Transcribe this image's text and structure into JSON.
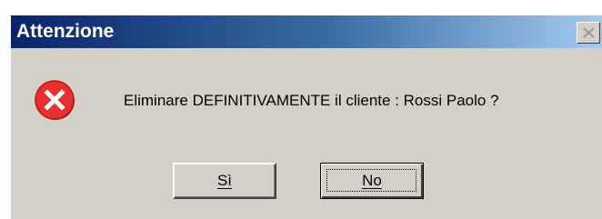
{
  "dialog": {
    "title": "Attenzione",
    "message": "Eliminare DEFINITIVAMENTE il cliente : Rossi Paolo ?",
    "icon": "error-icon",
    "buttons": {
      "yes_label": "Sì",
      "no_label": "No"
    },
    "focused_button": "No"
  },
  "colors": {
    "titlebar_start": "#0a246a",
    "titlebar_end": "#a6caf0",
    "dialog_face": "#d4d0c8",
    "error_red": "#e8312f"
  }
}
